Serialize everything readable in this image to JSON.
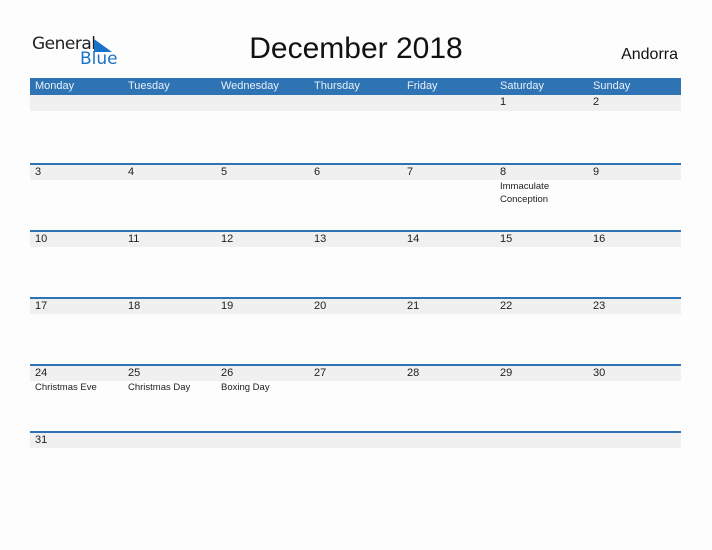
{
  "logo": {
    "word1": "General",
    "word2": "Blue"
  },
  "title": "December 2018",
  "country": "Andorra",
  "colors": {
    "accent": "#2e74b5",
    "date_strip": "#f0f0f0"
  },
  "weekdays": [
    "Monday",
    "Tuesday",
    "Wednesday",
    "Thursday",
    "Friday",
    "Saturday",
    "Sunday"
  ],
  "weeks": [
    [
      {
        "d": ""
      },
      {
        "d": ""
      },
      {
        "d": ""
      },
      {
        "d": ""
      },
      {
        "d": ""
      },
      {
        "d": "1"
      },
      {
        "d": "2"
      }
    ],
    [
      {
        "d": "3"
      },
      {
        "d": "4"
      },
      {
        "d": "5"
      },
      {
        "d": "6"
      },
      {
        "d": "7"
      },
      {
        "d": "8",
        "h": "Immaculate Conception"
      },
      {
        "d": "9"
      }
    ],
    [
      {
        "d": "10"
      },
      {
        "d": "11"
      },
      {
        "d": "12"
      },
      {
        "d": "13"
      },
      {
        "d": "14"
      },
      {
        "d": "15"
      },
      {
        "d": "16"
      }
    ],
    [
      {
        "d": "17"
      },
      {
        "d": "18"
      },
      {
        "d": "19"
      },
      {
        "d": "20"
      },
      {
        "d": "21"
      },
      {
        "d": "22"
      },
      {
        "d": "23"
      }
    ],
    [
      {
        "d": "24",
        "h": "Christmas Eve"
      },
      {
        "d": "25",
        "h": "Christmas Day"
      },
      {
        "d": "26",
        "h": "Boxing Day"
      },
      {
        "d": "27"
      },
      {
        "d": "28"
      },
      {
        "d": "29"
      },
      {
        "d": "30"
      }
    ],
    [
      {
        "d": "31"
      },
      {
        "d": ""
      },
      {
        "d": ""
      },
      {
        "d": ""
      },
      {
        "d": ""
      },
      {
        "d": ""
      },
      {
        "d": ""
      }
    ]
  ]
}
